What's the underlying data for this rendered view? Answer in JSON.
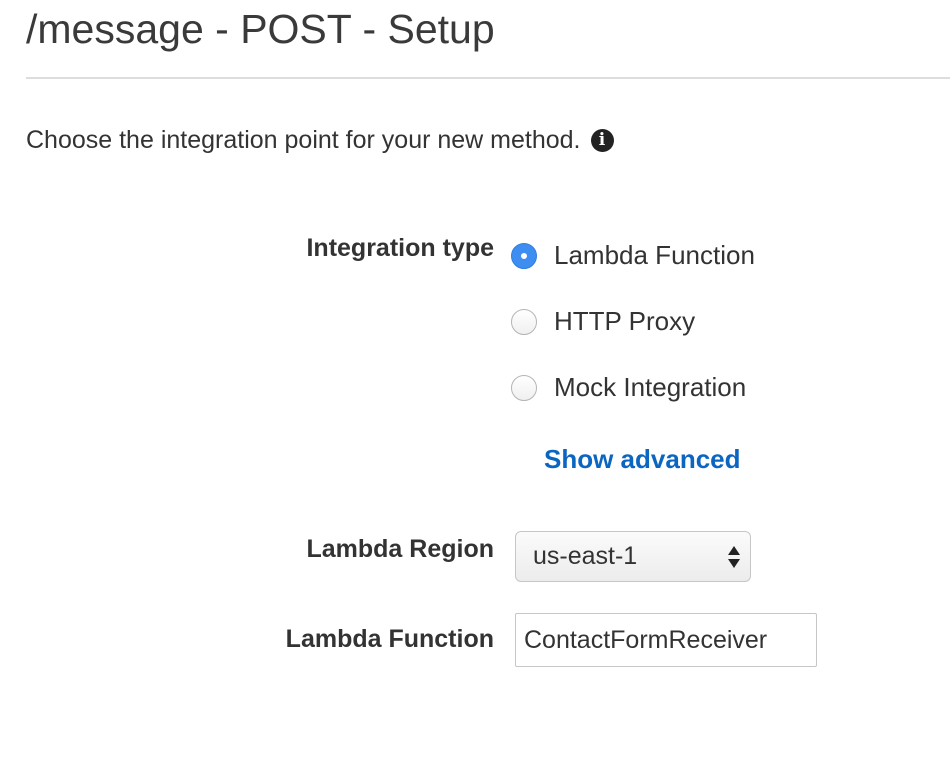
{
  "header": {
    "title": "/message - POST - Setup"
  },
  "intro": {
    "text": "Choose the integration point for your new method.",
    "info_icon": "info-circle-icon"
  },
  "integration": {
    "label": "Integration type",
    "options": [
      {
        "label": "Lambda Function",
        "selected": true
      },
      {
        "label": "HTTP Proxy",
        "selected": false
      },
      {
        "label": "Mock Integration",
        "selected": false
      }
    ],
    "show_advanced_label": "Show advanced"
  },
  "lambda_region": {
    "label": "Lambda Region",
    "value": "us-east-1"
  },
  "lambda_function": {
    "label": "Lambda Function",
    "value": "ContactFormReceiver"
  },
  "colors": {
    "accent": "#3d8ef0",
    "link": "#0b66c2",
    "text": "#333333",
    "divider": "#dddddd"
  }
}
